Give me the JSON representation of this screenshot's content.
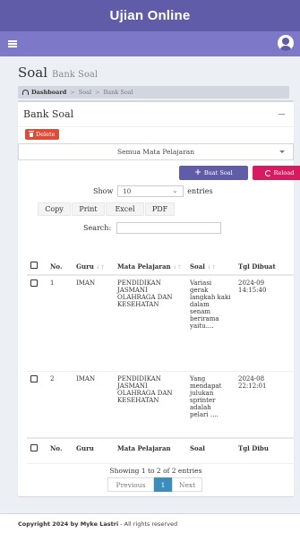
{
  "app": {
    "title": "Ujian Online"
  },
  "header": {
    "title": "Soal",
    "subtitle": "Bank Soal"
  },
  "breadcrumb": {
    "items": [
      "Dashboard",
      "Soal",
      "Bank Soal"
    ],
    "separator": ">"
  },
  "box": {
    "title": "Bank Soal",
    "collapse_glyph": "—"
  },
  "toolbar": {
    "delete_label": "Delete",
    "subject_select": "Semua Mata Pelajaran",
    "add_label": "Buat Soal",
    "reload_label": "Reload"
  },
  "length": {
    "prefix": "Show",
    "value": "10",
    "suffix": "entries"
  },
  "export": {
    "buttons": [
      "Copy",
      "Print",
      "Excel",
      "PDF"
    ]
  },
  "search": {
    "label": "Search:",
    "value": ""
  },
  "table": {
    "headers": {
      "no": "No.",
      "guru": "Guru",
      "mapel": "Mata Pelajaran",
      "soal": "Soal",
      "tgl": "Tgl Dibuat"
    },
    "rows": [
      {
        "no": "1",
        "guru": "IMAN",
        "mapel": "PENDIDIKAN JASMANI OLAHRAGA DAN KESEHATAN",
        "soal": "Variasi gerak langkah kaki dalam senam berirama yaitu....",
        "tgl1": "2024-09",
        "tgl2": "14:15:40"
      },
      {
        "no": "2",
        "guru": "IMAN",
        "mapel": "PENDIDIKAN JASMANI OLAHRAGA DAN KESEHATAN",
        "soal": "Yang mendapat julukan sprinter adalah pelari ....",
        "tgl1": "2024-08",
        "tgl2": "22:12:01"
      }
    ],
    "footer": {
      "no": "No.",
      "guru": "Guru",
      "mapel": "Mata Pelajaran",
      "soal": "Soal",
      "tgl": "Tgl Dibu"
    }
  },
  "info": "Showing 1 to 2 of 2 entries",
  "pagination": {
    "prev": "Previous",
    "current": "1",
    "next": "Next"
  },
  "footer": {
    "bold": "Copyright 2024 by Myke Lastri",
    "rest": " - All rights reserved"
  },
  "colors": {
    "primary": "#605ca8",
    "navbar": "#7d78c7",
    "danger": "#dd4b39",
    "reload": "#d81b60",
    "page_active": "#3c8dbc"
  }
}
